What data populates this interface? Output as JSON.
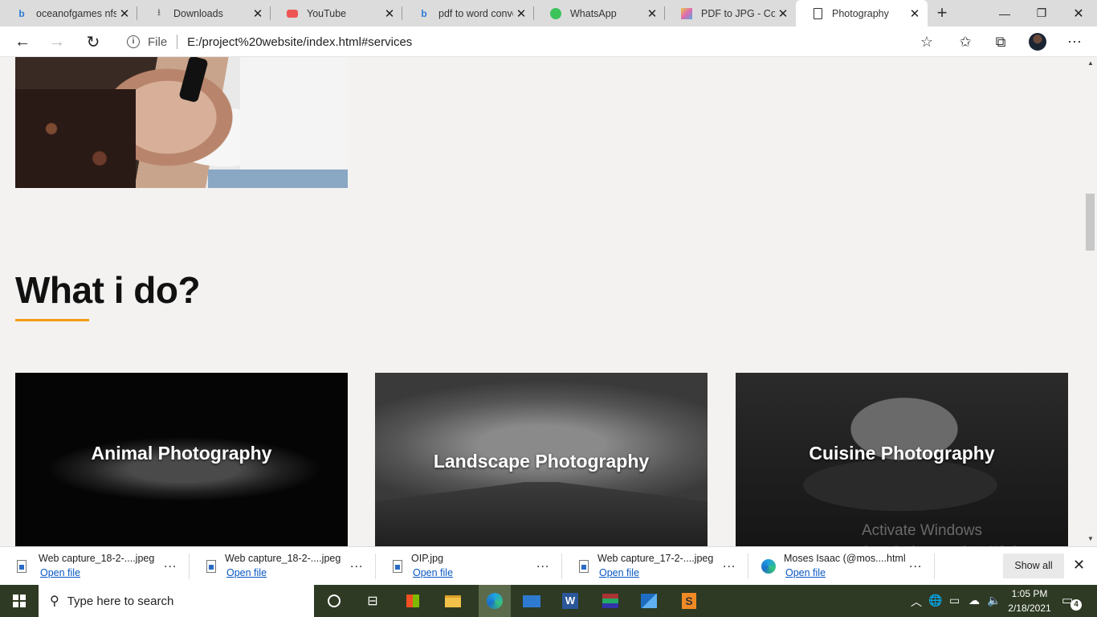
{
  "browser": {
    "tabs": [
      {
        "label": "oceanofgames nfs",
        "icon": "bing-icon",
        "active": false
      },
      {
        "label": "Downloads",
        "icon": "download-icon",
        "active": false
      },
      {
        "label": "YouTube",
        "icon": "youtube-icon",
        "active": false
      },
      {
        "label": "pdf to word conve",
        "icon": "bing-icon",
        "active": false
      },
      {
        "label": "WhatsApp",
        "icon": "whatsapp-icon",
        "active": false
      },
      {
        "label": "PDF to JPG - Conv",
        "icon": "pdf-converter-icon",
        "active": false
      },
      {
        "label": "Photography",
        "icon": "page-icon",
        "active": true
      }
    ],
    "address": {
      "scheme": "File",
      "url": "E:/project%20website/index.html#services"
    }
  },
  "page": {
    "section_title": "What i do?",
    "accent_color": "#f39c12",
    "services": [
      {
        "label": "Animal Photography"
      },
      {
        "label": "Landscape Photography"
      },
      {
        "label": "Cuisine Photography"
      }
    ],
    "watermark": {
      "line1": "Activate Windows",
      "line2": "Go to Settings to activate Windows."
    }
  },
  "downloads": {
    "items": [
      {
        "name": "Web capture_18-2-....jpeg",
        "action": "Open file"
      },
      {
        "name": "Web capture_18-2-....jpeg",
        "action": "Open file"
      },
      {
        "name": "OIP.jpg",
        "action": "Open file"
      },
      {
        "name": "Web capture_17-2-....jpeg",
        "action": "Open file"
      },
      {
        "name": "Moses Isaac (@mos....html",
        "action": "Open file"
      }
    ],
    "show_all": "Show all",
    "more": "..."
  },
  "taskbar": {
    "search_placeholder": "Type here to search",
    "time": "1:05 PM",
    "date": "2/18/2021",
    "notification_count": "4"
  }
}
